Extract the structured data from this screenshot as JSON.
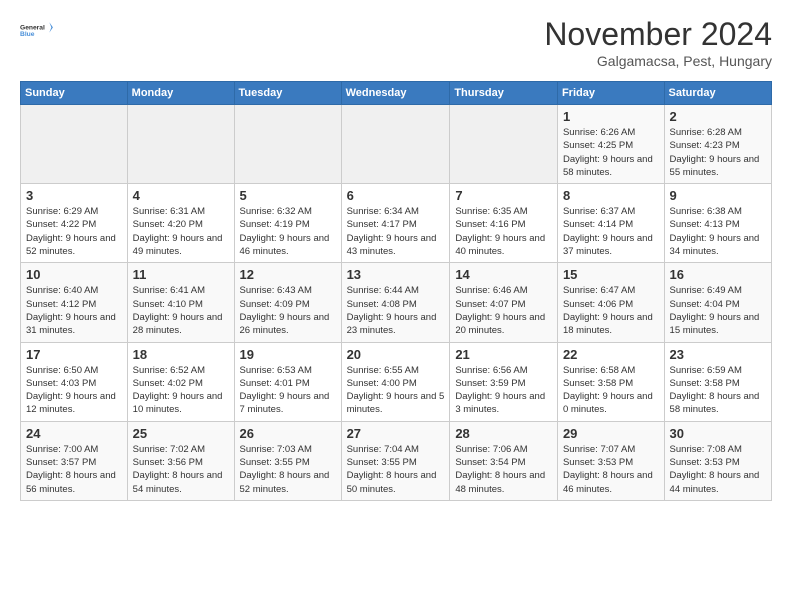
{
  "logo": {
    "line1": "General",
    "line2": "Blue"
  },
  "title": "November 2024",
  "subtitle": "Galgamacsa, Pest, Hungary",
  "days_of_week": [
    "Sunday",
    "Monday",
    "Tuesday",
    "Wednesday",
    "Thursday",
    "Friday",
    "Saturday"
  ],
  "weeks": [
    [
      {
        "day": "",
        "info": ""
      },
      {
        "day": "",
        "info": ""
      },
      {
        "day": "",
        "info": ""
      },
      {
        "day": "",
        "info": ""
      },
      {
        "day": "",
        "info": ""
      },
      {
        "day": "1",
        "info": "Sunrise: 6:26 AM\nSunset: 4:25 PM\nDaylight: 9 hours and 58 minutes."
      },
      {
        "day": "2",
        "info": "Sunrise: 6:28 AM\nSunset: 4:23 PM\nDaylight: 9 hours and 55 minutes."
      }
    ],
    [
      {
        "day": "3",
        "info": "Sunrise: 6:29 AM\nSunset: 4:22 PM\nDaylight: 9 hours and 52 minutes."
      },
      {
        "day": "4",
        "info": "Sunrise: 6:31 AM\nSunset: 4:20 PM\nDaylight: 9 hours and 49 minutes."
      },
      {
        "day": "5",
        "info": "Sunrise: 6:32 AM\nSunset: 4:19 PM\nDaylight: 9 hours and 46 minutes."
      },
      {
        "day": "6",
        "info": "Sunrise: 6:34 AM\nSunset: 4:17 PM\nDaylight: 9 hours and 43 minutes."
      },
      {
        "day": "7",
        "info": "Sunrise: 6:35 AM\nSunset: 4:16 PM\nDaylight: 9 hours and 40 minutes."
      },
      {
        "day": "8",
        "info": "Sunrise: 6:37 AM\nSunset: 4:14 PM\nDaylight: 9 hours and 37 minutes."
      },
      {
        "day": "9",
        "info": "Sunrise: 6:38 AM\nSunset: 4:13 PM\nDaylight: 9 hours and 34 minutes."
      }
    ],
    [
      {
        "day": "10",
        "info": "Sunrise: 6:40 AM\nSunset: 4:12 PM\nDaylight: 9 hours and 31 minutes."
      },
      {
        "day": "11",
        "info": "Sunrise: 6:41 AM\nSunset: 4:10 PM\nDaylight: 9 hours and 28 minutes."
      },
      {
        "day": "12",
        "info": "Sunrise: 6:43 AM\nSunset: 4:09 PM\nDaylight: 9 hours and 26 minutes."
      },
      {
        "day": "13",
        "info": "Sunrise: 6:44 AM\nSunset: 4:08 PM\nDaylight: 9 hours and 23 minutes."
      },
      {
        "day": "14",
        "info": "Sunrise: 6:46 AM\nSunset: 4:07 PM\nDaylight: 9 hours and 20 minutes."
      },
      {
        "day": "15",
        "info": "Sunrise: 6:47 AM\nSunset: 4:06 PM\nDaylight: 9 hours and 18 minutes."
      },
      {
        "day": "16",
        "info": "Sunrise: 6:49 AM\nSunset: 4:04 PM\nDaylight: 9 hours and 15 minutes."
      }
    ],
    [
      {
        "day": "17",
        "info": "Sunrise: 6:50 AM\nSunset: 4:03 PM\nDaylight: 9 hours and 12 minutes."
      },
      {
        "day": "18",
        "info": "Sunrise: 6:52 AM\nSunset: 4:02 PM\nDaylight: 9 hours and 10 minutes."
      },
      {
        "day": "19",
        "info": "Sunrise: 6:53 AM\nSunset: 4:01 PM\nDaylight: 9 hours and 7 minutes."
      },
      {
        "day": "20",
        "info": "Sunrise: 6:55 AM\nSunset: 4:00 PM\nDaylight: 9 hours and 5 minutes."
      },
      {
        "day": "21",
        "info": "Sunrise: 6:56 AM\nSunset: 3:59 PM\nDaylight: 9 hours and 3 minutes."
      },
      {
        "day": "22",
        "info": "Sunrise: 6:58 AM\nSunset: 3:58 PM\nDaylight: 9 hours and 0 minutes."
      },
      {
        "day": "23",
        "info": "Sunrise: 6:59 AM\nSunset: 3:58 PM\nDaylight: 8 hours and 58 minutes."
      }
    ],
    [
      {
        "day": "24",
        "info": "Sunrise: 7:00 AM\nSunset: 3:57 PM\nDaylight: 8 hours and 56 minutes."
      },
      {
        "day": "25",
        "info": "Sunrise: 7:02 AM\nSunset: 3:56 PM\nDaylight: 8 hours and 54 minutes."
      },
      {
        "day": "26",
        "info": "Sunrise: 7:03 AM\nSunset: 3:55 PM\nDaylight: 8 hours and 52 minutes."
      },
      {
        "day": "27",
        "info": "Sunrise: 7:04 AM\nSunset: 3:55 PM\nDaylight: 8 hours and 50 minutes."
      },
      {
        "day": "28",
        "info": "Sunrise: 7:06 AM\nSunset: 3:54 PM\nDaylight: 8 hours and 48 minutes."
      },
      {
        "day": "29",
        "info": "Sunrise: 7:07 AM\nSunset: 3:53 PM\nDaylight: 8 hours and 46 minutes."
      },
      {
        "day": "30",
        "info": "Sunrise: 7:08 AM\nSunset: 3:53 PM\nDaylight: 8 hours and 44 minutes."
      }
    ]
  ]
}
